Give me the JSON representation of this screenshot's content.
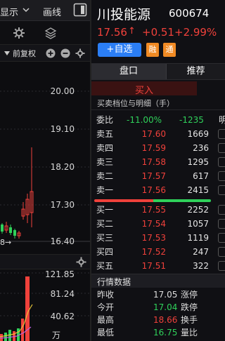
{
  "left": {
    "toolbar_label_1": "显示",
    "toolbar_label_2": "画线",
    "fq_label": "前复权",
    "price_ticks": [
      "20.00",
      "19.10",
      "18.20",
      "17.30",
      "16.40"
    ],
    "vol_ticks": [
      "121.85",
      "81.24",
      "40.62",
      "万"
    ],
    "marker_text": "8→"
  },
  "stock": {
    "name": "川投能源",
    "code": "600674",
    "price": "17.56",
    "arrow": "↑",
    "change": "+0.51",
    "change_pct": "+2.99%",
    "add_label": "+自选",
    "tag_rong": "融",
    "tag_tong": "通"
  },
  "tabs": {
    "pankou": "盘口",
    "tuijian": "推荐"
  },
  "buy_header": "买入",
  "section_title": "买卖档位与明细（手）",
  "weibi": {
    "label": "委比",
    "pct": "-11.00%",
    "diff": "-1235",
    "side": "明"
  },
  "asks": [
    {
      "label": "卖五",
      "price": "17.60",
      "volume": "1669"
    },
    {
      "label": "卖四",
      "price": "17.59",
      "volume": "236"
    },
    {
      "label": "卖三",
      "price": "17.58",
      "volume": "1295"
    },
    {
      "label": "卖二",
      "price": "17.57",
      "volume": "617"
    },
    {
      "label": "卖一",
      "price": "17.56",
      "volume": "2415"
    }
  ],
  "bids": [
    {
      "label": "买一",
      "price": "17.55",
      "volume": "2252"
    },
    {
      "label": "买二",
      "price": "17.54",
      "volume": "1057"
    },
    {
      "label": "买三",
      "price": "17.53",
      "volume": "1119"
    },
    {
      "label": "买四",
      "price": "17.52",
      "volume": "247"
    },
    {
      "label": "买五",
      "price": "17.51",
      "volume": "322"
    }
  ],
  "quote_title": "行情数据",
  "quote": {
    "zuoshou_label": "昨收",
    "zuoshou": "17.05",
    "zhangting": "涨停",
    "jinkai_label": "今开",
    "jinkai": "17.04",
    "dieting": "跌停",
    "zuigao_label": "最高",
    "zuigao": "18.66",
    "huanshou": "换手",
    "zuidi_label": "最低",
    "zuidi": "16.75",
    "liangbi": "量比"
  },
  "colors": {
    "up": "#f0413b",
    "down": "#2fd15a",
    "accent": "#2b7ef5",
    "tag": "#f08a24"
  }
}
